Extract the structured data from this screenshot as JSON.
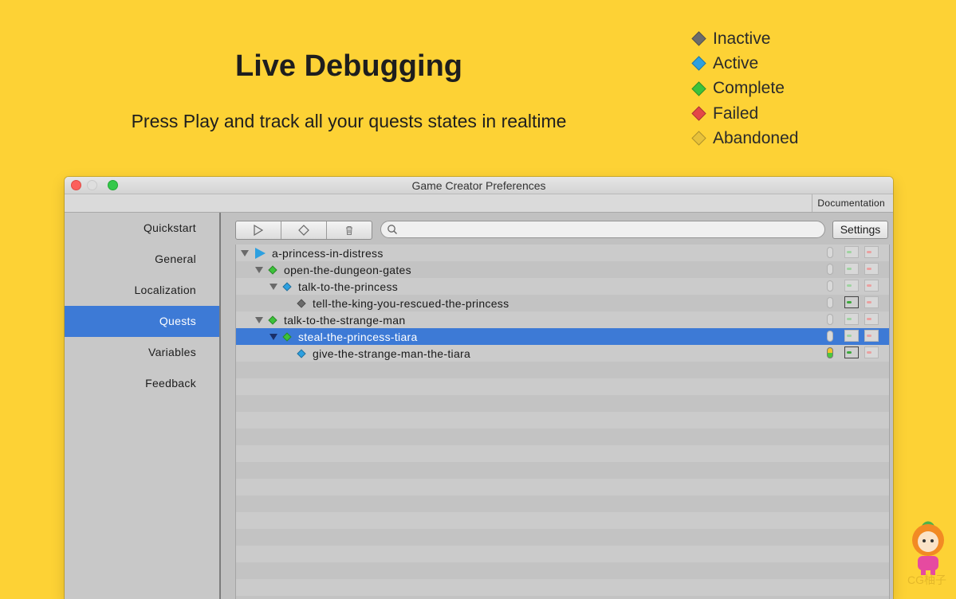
{
  "hero": {
    "title": "Live Debugging",
    "subtitle": "Press Play and track all your quests states in realtime"
  },
  "legend": [
    {
      "label": "Inactive",
      "color": "#6b6b6b"
    },
    {
      "label": "Active",
      "color": "#2da0e0"
    },
    {
      "label": "Complete",
      "color": "#3cc23a"
    },
    {
      "label": "Failed",
      "color": "#e44747"
    },
    {
      "label": "Abandoned",
      "color": "#e8c23a"
    }
  ],
  "window": {
    "title": "Game Creator Preferences",
    "documentation_label": "Documentation"
  },
  "sidebar": {
    "items": [
      {
        "label": "Quickstart"
      },
      {
        "label": "General"
      },
      {
        "label": "Localization"
      },
      {
        "label": "Quests",
        "active": true
      },
      {
        "label": "Variables"
      },
      {
        "label": "Feedback"
      }
    ]
  },
  "toolbar": {
    "play_icon": "play-icon",
    "diamond_icon": "diamond-icon",
    "trash_icon": "trash-icon",
    "search_placeholder": "",
    "settings_label": "Settings"
  },
  "quests": [
    {
      "label": "a-princess-in-distress",
      "depth": 0,
      "expanded": true,
      "icon": "play",
      "state": "active",
      "toggle": "off",
      "cond": "light"
    },
    {
      "label": "open-the-dungeon-gates",
      "depth": 1,
      "expanded": true,
      "icon": "diamond",
      "state": "complete",
      "toggle": "off",
      "cond": "light"
    },
    {
      "label": "talk-to-the-princess",
      "depth": 2,
      "expanded": true,
      "icon": "diamond",
      "state": "active",
      "toggle": "off",
      "cond": "light"
    },
    {
      "label": "tell-the-king-you-rescued-the-princess",
      "depth": 3,
      "expanded": false,
      "icon": "diamond",
      "state": "inactive",
      "toggle": "off",
      "cond": "strong"
    },
    {
      "label": "talk-to-the-strange-man",
      "depth": 1,
      "expanded": true,
      "icon": "diamond",
      "state": "complete",
      "toggle": "off",
      "cond": "light"
    },
    {
      "label": "steal-the-princess-tiara",
      "depth": 2,
      "expanded": true,
      "icon": "diamond",
      "state": "complete",
      "toggle": "off",
      "cond": "light",
      "selected": true
    },
    {
      "label": "give-the-strange-man-the-tiara",
      "depth": 3,
      "expanded": false,
      "icon": "diamond",
      "state": "active",
      "toggle": "on",
      "cond": "strong"
    }
  ],
  "state_colors": {
    "inactive": "#6b6b6b",
    "active": "#2da0e0",
    "complete": "#3cc23a",
    "failed": "#e44747",
    "abandoned": "#e8c23a"
  },
  "watermark": {
    "text": "CG柚子"
  }
}
